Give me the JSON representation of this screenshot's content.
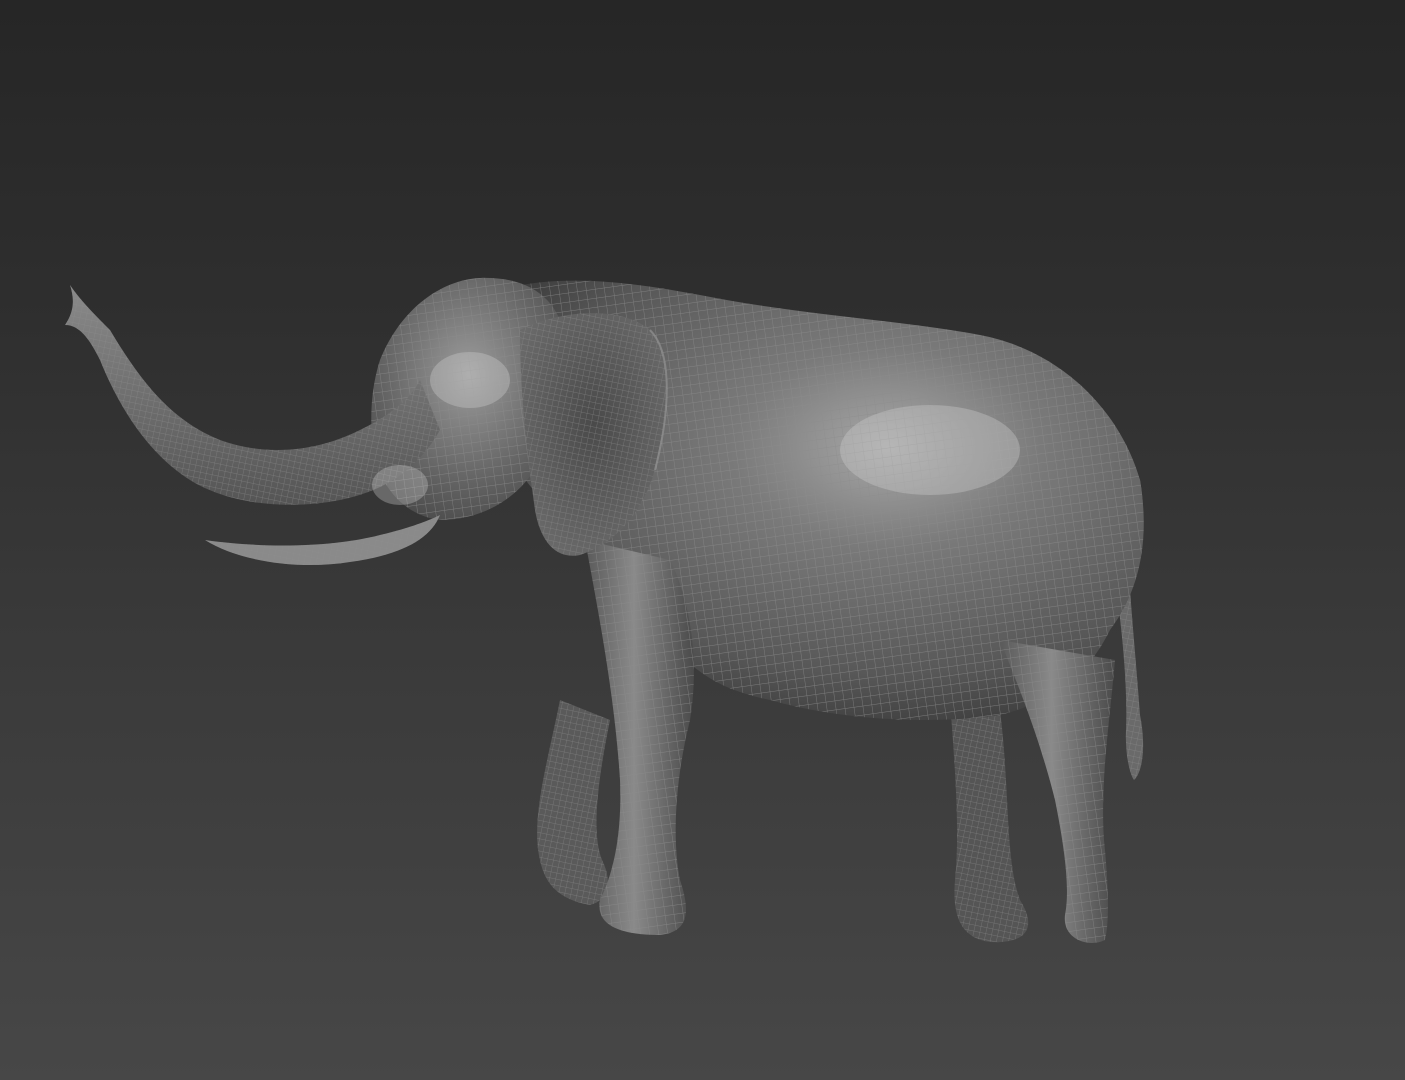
{
  "viewport": {
    "background_top": "#262626",
    "background_bottom": "#474747"
  },
  "model": {
    "subject": "elephant-icon",
    "render_mode": "wireframe-on-shaded",
    "surface_color": "#6b6b6b",
    "highlight_color": "#a5a5a5",
    "wire_color": "#8c8c8c"
  }
}
